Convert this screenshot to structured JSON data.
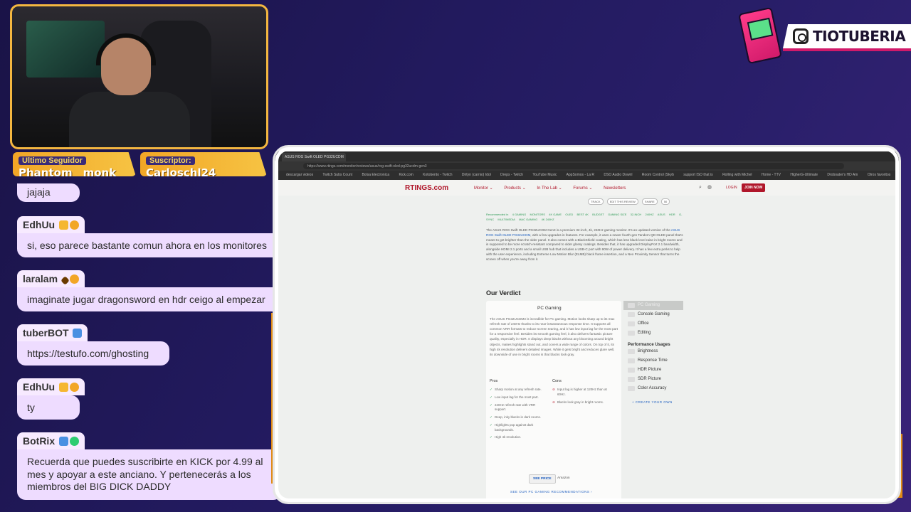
{
  "badges": {
    "follower_label": "Ultimo Seguidor",
    "follower_value": "Phantom__monk",
    "subscriber_label": "Suscriptor:",
    "subscriber_value": "Carloschl24"
  },
  "brand": {
    "handle": "TIOTUBERIA",
    "icon": "instagram-icon"
  },
  "chat": {
    "messages": [
      {
        "user": "",
        "text": "jajaja"
      },
      {
        "user": "EdhUu",
        "text": "si, eso parece bastante comun ahora en los monitores"
      },
      {
        "user": "laralam",
        "text": "imaginate jugar dragonsword en hdr ceigo al empezar"
      },
      {
        "user": "tuberBOT",
        "text": "https://testufo.com/ghosting"
      },
      {
        "user": "EdhUu",
        "text": "ty"
      },
      {
        "user": "BotRix",
        "text": "Recuerda que puedes suscribirte en KICK por 4.99 al mes y apoyar a este anciano. Y pertenecerás a los miembros del BIG DICK DADDY"
      }
    ]
  },
  "browser": {
    "tab_title": "ASUS ROG Swift OLED PG32UCDM",
    "url": "https://www.rtings.com/monitor/reviews/asus/rog-swift-oled-pg32ucdm-gen3",
    "bookmarks": [
      "descargar videos",
      "Twitch Subs Count",
      "Bolsa Electronica",
      "Kick.com",
      "Kotobento - Twitch",
      "Dirtyn (carnio) Idol",
      "Dreps - Twitch",
      "YouTube Music",
      "AppSomos - La R",
      "DSO Audio Downl",
      "Room Control (Skyb",
      "support ISO that is",
      "Rolling with Michel",
      "Home - TTV",
      "HigherG-Ultimate",
      "Droboater's HD Am",
      "Otros favoritos"
    ]
  },
  "site": {
    "logo": "RTINGS.com",
    "nav": [
      "Monitor ⌄",
      "Products ⌄",
      "In The Lab ⌄",
      "Forums ⌄",
      "Newsletters"
    ],
    "login": "LOGIN",
    "join": "JOIN NOW",
    "pills": [
      "TRACK",
      "EDIT THIS REVIEW",
      "SHARE",
      "50"
    ],
    "rec_label": "Recommended in",
    "rec_tags": [
      "4 GAMING",
      "MONITORS",
      "4K GAME",
      "OLED",
      "BEST 4K",
      "BUDGET",
      "GAMING SIZE",
      "32-INCH",
      "240HZ",
      "ASUS",
      "HDR",
      "G-SYNC",
      "MULTIMEDIA",
      "MAC GAMING",
      "4K 240HZ"
    ],
    "intro_before": "The ASUS ROG Swift OLED PG32UCDM Gen3 is a premium 32-inch, 4k, 240Hz gaming monitor. It's an updated version of the ",
    "intro_link": "ASUS ROG Swift OLED PG32UCDM",
    "intro_after": ", with a few upgrades in features. For example, it uses a newer fourth-gen Tandem QD-OLED panel that's meant to get brighter than the older panel. It also comes with a BlackShield coating, which has less black level raise in bright rooms and is supposed to be more scratch-resistant compared to older glossy coatings. Besides that, it has upgraded DisplayPort 2.1 bandwidth, alongside HDMI 2.1 ports and a small USB hub that includes a USB-C port with 90W of power delivery. It has a few extra perks to help with the user experience, including Extreme Low Motion Blur (ELMB) black frame insertion, and a Neo Proximity Sensor that turns the screen off when you're away from it.",
    "verdict_title": "Our Verdict",
    "usage_title": "PC Gaming",
    "usage_desc": "The ASUS PG32UCDM3 is incredible for PC gaming. Motion looks sharp up to its max refresh rate of 240Hz thanks to its near-instantaneous response time. It supports all common VRR formats to reduce screen tearing, and it has low input lag for the most part for a responsive feel. Besides its smooth gaming feel, it also delivers fantastic picture quality, especially in HDR. It displays deep blacks without any blooming around bright objects, makes highlights stand out, and covers a wide range of colors. On top of it, its high 4k resolution delivers detailed images. While it gets bright and reduces glare well, its downside of use in bright rooms is that blacks look gray.",
    "pros_label": "Pros",
    "cons_label": "Cons",
    "pros": [
      "Sharp motion at any refresh rate.",
      "Low input lag for the most part.",
      "240Hz refresh rate with VRR support.",
      "Deep, inky blacks in dark rooms.",
      "Highlights pop against dark backgrounds.",
      "High 4k resolution."
    ],
    "cons": [
      "Input lag is higher at 120Hz than at 60Hz.",
      "Blacks look gray in bright rooms."
    ],
    "see_price": "SEE PRICE",
    "retailer": "Amazon",
    "see_recs": "SEE OUR PC GAMING RECOMMENDATIONS ›",
    "usages": [
      "PC Gaming",
      "Console Gaming",
      "Office",
      "Editing"
    ],
    "perf_header": "Performance Usages",
    "perf_usages": [
      "Brightness",
      "Response Time",
      "HDR Picture",
      "SDR Picture",
      "Color Accuracy"
    ],
    "create_own": "+ CREATE YOUR OWN"
  }
}
